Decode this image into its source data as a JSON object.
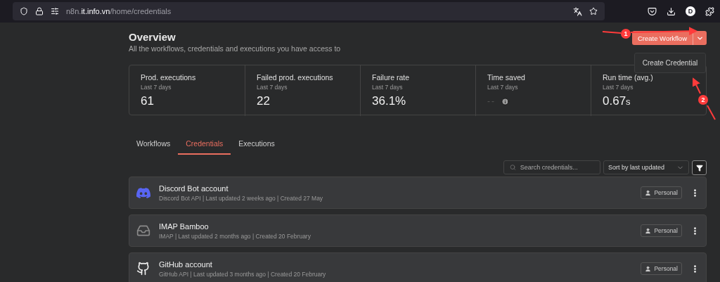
{
  "browser": {
    "url": {
      "subdomain": "n8n.",
      "domain": "it.info.vn",
      "path": "/home/credentials"
    },
    "profile_initial": "D"
  },
  "overview": {
    "title": "Overview",
    "subtitle": "All the workflows, credentials and executions you have access to"
  },
  "create_button": {
    "label": "Create Workflow"
  },
  "dropdown": {
    "items": [
      "Create Credential"
    ]
  },
  "stats": [
    {
      "label": "Prod. executions",
      "period": "Last 7 days",
      "value": "61",
      "kind": "value"
    },
    {
      "label": "Failed prod. executions",
      "period": "Last 7 days",
      "value": "22",
      "kind": "value"
    },
    {
      "label": "Failure rate",
      "period": "Last 7 days",
      "value": "36.1%",
      "kind": "value"
    },
    {
      "label": "Time saved",
      "period": "Last 7 days",
      "value": "--",
      "kind": "empty"
    },
    {
      "label": "Run time (avg.)",
      "period": "Last 7 days",
      "value": "0.67",
      "unit": "s",
      "kind": "value"
    }
  ],
  "tabs": [
    {
      "label": "Workflows",
      "selected": false
    },
    {
      "label": "Credentials",
      "selected": true
    },
    {
      "label": "Executions",
      "selected": false
    }
  ],
  "search": {
    "placeholder": "Search credentials..."
  },
  "sort": {
    "value": "Sort by last updated"
  },
  "credentials": [
    {
      "name": "Discord Bot account",
      "meta": "Discord Bot API | Last updated 2 weeks ago | Created 27 May",
      "kind": "discord",
      "owner": "Personal"
    },
    {
      "name": "IMAP Bamboo",
      "meta": "IMAP | Last updated 2 months ago | Created 20 February",
      "kind": "imap",
      "owner": "Personal"
    },
    {
      "name": "GitHub account",
      "meta": "GitHub API | Last updated 3 months ago | Created 20 February",
      "kind": "github",
      "owner": "Personal"
    }
  ],
  "annotations": [
    {
      "number": "1"
    },
    {
      "number": "2"
    }
  ]
}
